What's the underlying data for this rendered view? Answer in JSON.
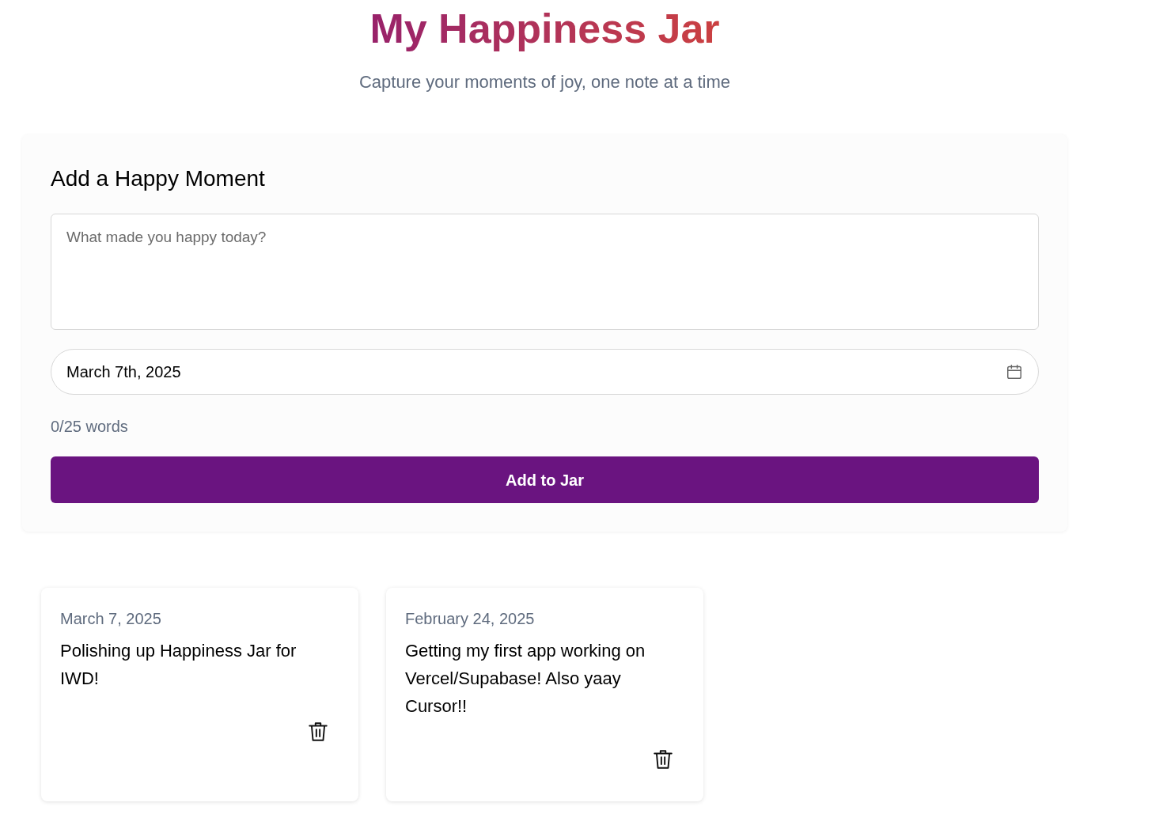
{
  "header": {
    "title": "My Happiness Jar",
    "subtitle": "Capture your moments of joy, one note at a time"
  },
  "form": {
    "heading": "Add a Happy Moment",
    "note": {
      "placeholder": "What made you happy today?"
    },
    "date": {
      "value": "March 7th, 2025"
    },
    "word_count": "0/25 words",
    "submit": "Add to Jar"
  },
  "moments": [
    {
      "date": "March 7, 2025",
      "text": "Polishing up Happiness Jar for IWD!"
    },
    {
      "date": "February 24, 2025",
      "text": "Getting my first app working on Vercel/Supabase! Also yaay Cursor!!"
    }
  ]
}
